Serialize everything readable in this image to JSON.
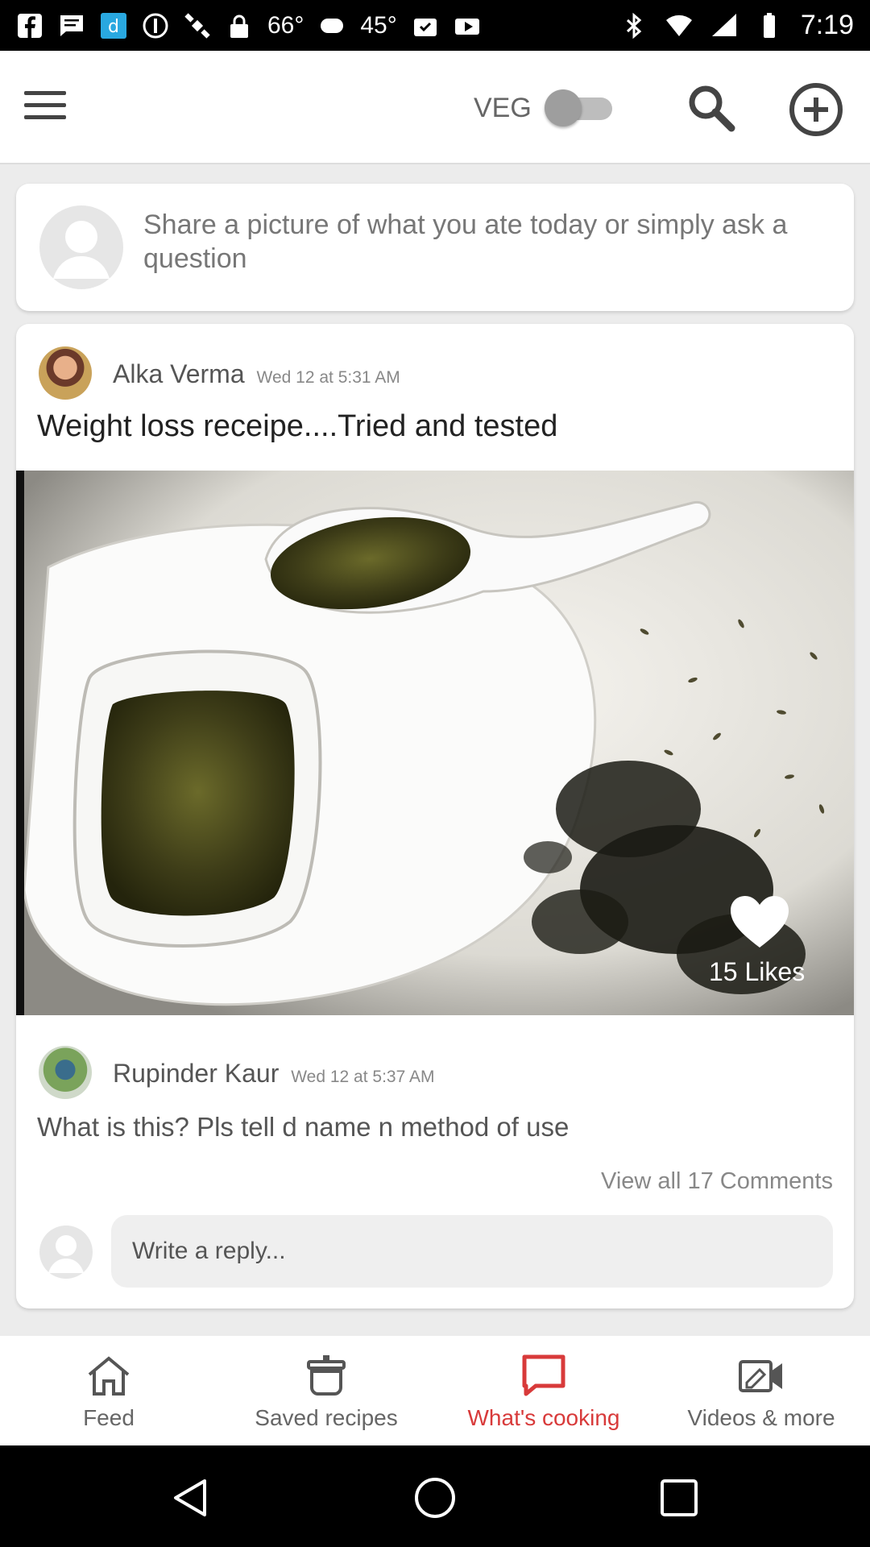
{
  "status_bar": {
    "temp1": "66°",
    "temp2": "45°",
    "time": "7:19"
  },
  "app_bar": {
    "veg_label": "VEG",
    "veg_toggle_on": false
  },
  "composer": {
    "prompt": "Share a picture of what you ate today or simply ask a question"
  },
  "post": {
    "author": "Alka Verma",
    "time": "Wed 12 at 5:31 AM",
    "title": "Weight loss receipe....Tried and tested",
    "likes_label": "15 Likes"
  },
  "comment": {
    "author": "Rupinder Kaur",
    "time": "Wed 12 at 5:37 AM",
    "text": "What is this? Pls tell d name n method of use",
    "view_all": "View all 17  Comments"
  },
  "reply": {
    "placeholder": "Write a reply..."
  },
  "bottom_nav": {
    "items": [
      {
        "label": "Feed",
        "icon": "home-icon"
      },
      {
        "label": "Saved recipes",
        "icon": "cooking-pot-icon"
      },
      {
        "label": "What's cooking",
        "icon": "chat-bubble-icon"
      },
      {
        "label": "Videos & more",
        "icon": "video-icon"
      }
    ],
    "active_index": 2
  },
  "colors": {
    "accent": "#d83a3a",
    "text_muted": "#888888"
  }
}
